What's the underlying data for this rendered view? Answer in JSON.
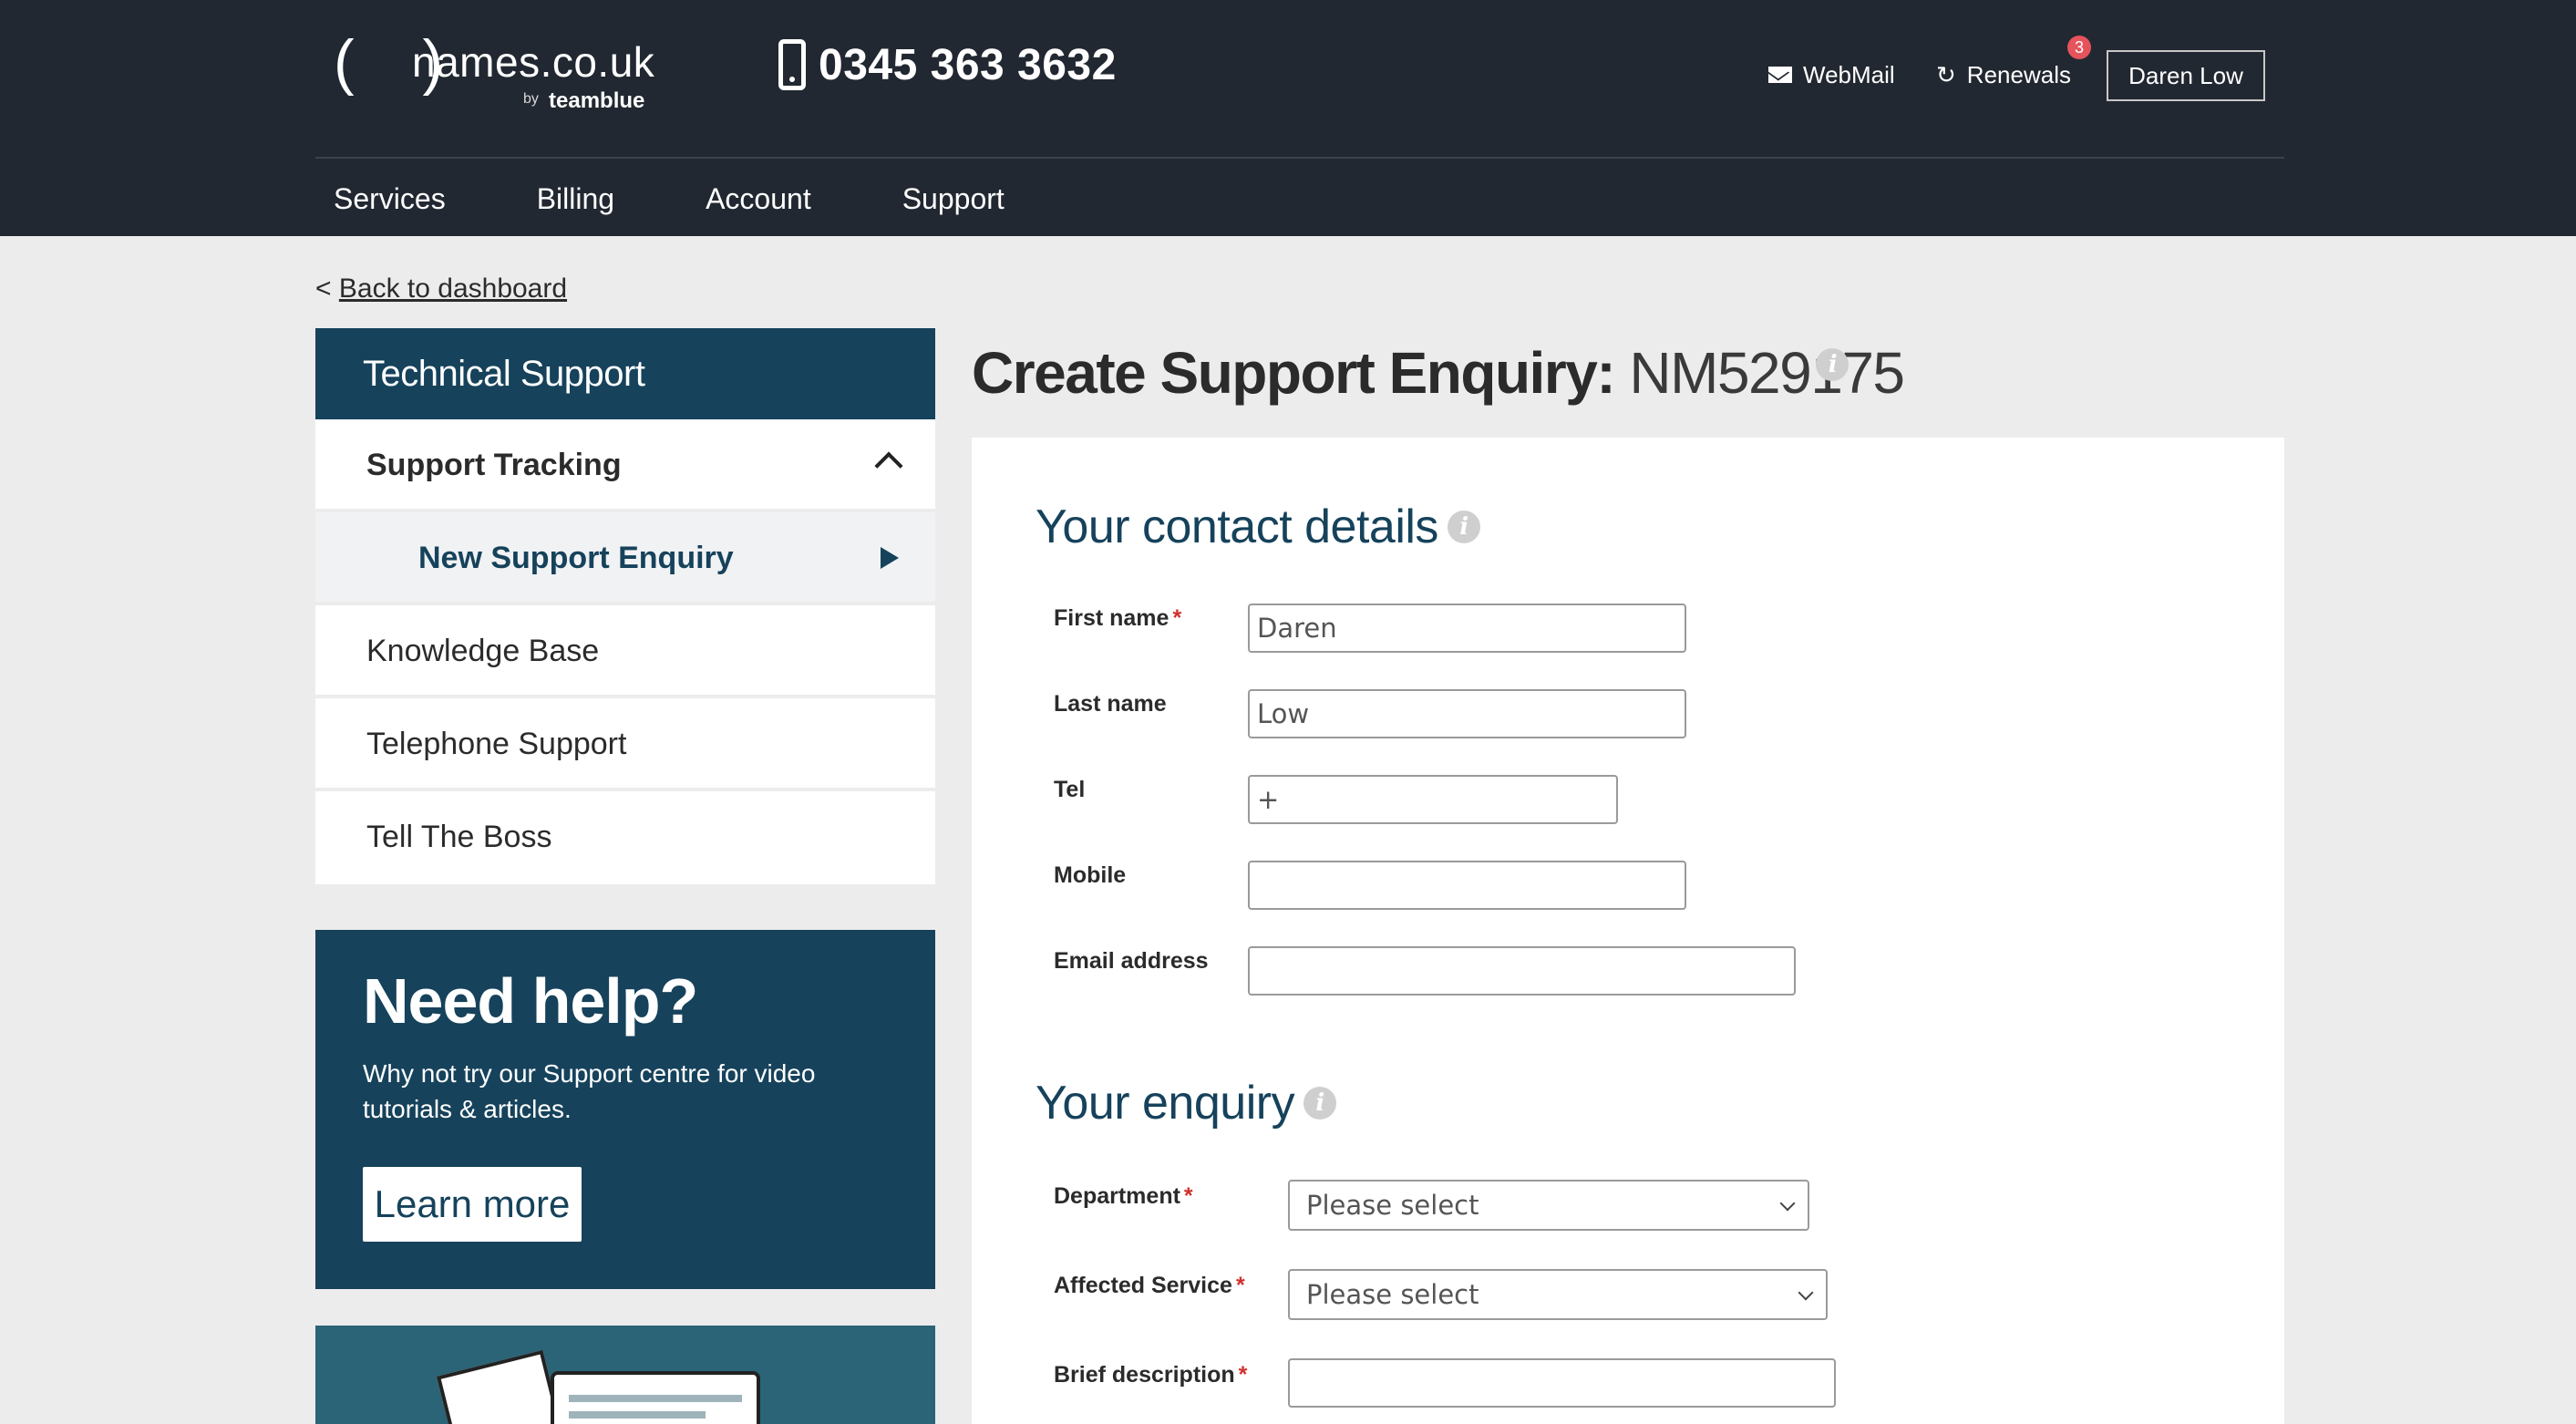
{
  "header": {
    "logo_brackets": "( )",
    "logo_domain": "names.co.uk",
    "logo_by": "by",
    "logo_company": "teamblue",
    "phone": "0345 363 3632",
    "webmail": "WebMail",
    "renewals": "Renewals",
    "renewals_badge": "3",
    "user": "Daren Low"
  },
  "nav": [
    "Services",
    "Billing",
    "Account",
    "Support"
  ],
  "breadcrumb": {
    "prefix": "<",
    "link": "Back to dashboard"
  },
  "sidebar": {
    "heading": "Technical Support",
    "tracking": "Support Tracking",
    "sub_item": "New Support Enquiry",
    "items": [
      "Knowledge Base",
      "Telephone Support",
      "Tell The Boss"
    ]
  },
  "help": {
    "title": "Need help?",
    "text": "Why not try our Support centre for video tutorials & articles.",
    "button": "Learn more"
  },
  "page": {
    "title_bold": "Create Support Enquiry:",
    "title_ref": "NM529175",
    "info_glyph": "i"
  },
  "contact": {
    "heading": "Your contact details",
    "first_name_label": "First name",
    "first_name_value": "Daren",
    "last_name_label": "Last name",
    "last_name_value": "Low",
    "tel_label": "Tel",
    "tel_value": "+",
    "mobile_label": "Mobile",
    "mobile_value": "",
    "email_label": "Email address",
    "email_value": ""
  },
  "enquiry": {
    "heading": "Your enquiry",
    "department_label": "Department",
    "department_value": "Please select",
    "service_label": "Affected Service",
    "service_value": "Please select",
    "brief_label": "Brief description",
    "brief_value": ""
  },
  "required_mark": "*",
  "colors": {
    "brand": "#16425b",
    "header_bg": "#222831",
    "required": "#d0312d",
    "badge": "#e5535b"
  }
}
